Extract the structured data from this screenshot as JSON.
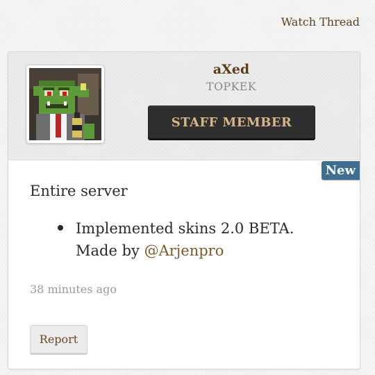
{
  "header": {
    "watch_thread": "Watch Thread"
  },
  "user": {
    "name": "aXed",
    "title": "TOPKEK",
    "banner": "STAFF MEMBER",
    "avatar_icon": "orc-avatar-icon"
  },
  "post": {
    "badge": "New",
    "title": "Entire server",
    "items": [
      {
        "text": "Implemented skins 2.0 BETA.",
        "text2": "Made by ",
        "mention": "@Arjenpro"
      }
    ],
    "time": "38 minutes ago",
    "report_label": "Report"
  },
  "colors": {
    "banner_bg": "#2f2f2f",
    "banner_text": "#d7b58a",
    "badge_bg": "#3f6e91",
    "link": "#5b3f1f"
  }
}
